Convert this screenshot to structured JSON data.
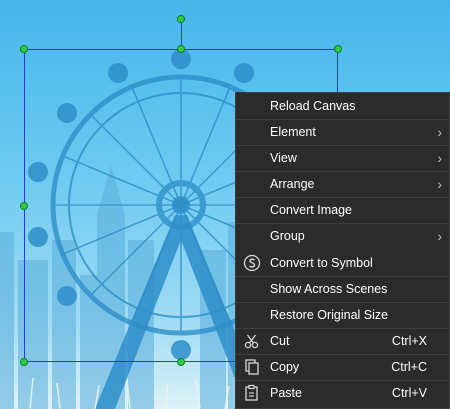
{
  "menu": {
    "items": [
      {
        "label": "Reload Canvas"
      },
      {
        "label": "Element",
        "submenu": true
      },
      {
        "label": "View",
        "submenu": true
      },
      {
        "label": "Arrange",
        "submenu": true
      },
      {
        "label": "Convert Image"
      },
      {
        "label": "Group",
        "submenu": true
      },
      {
        "label": "Convert to Symbol",
        "highlighted": true,
        "icon": "symbol-icon"
      },
      {
        "label": "Show Across Scenes"
      },
      {
        "label": "Restore Original Size"
      },
      {
        "label": "Cut",
        "shortcut": "Ctrl+X",
        "icon": "scissors-icon"
      },
      {
        "label": "Copy",
        "shortcut": "Ctrl+C",
        "icon": "copy-icon"
      },
      {
        "label": "Paste",
        "shortcut": "Ctrl+V",
        "icon": "paste-icon"
      }
    ],
    "submenu_arrow": "›"
  },
  "colors": {
    "menu_bg": "#2b2b2b",
    "highlight_border": "#2fa84f",
    "selection": "#1f3fd9",
    "handle": "#2ecc40"
  }
}
